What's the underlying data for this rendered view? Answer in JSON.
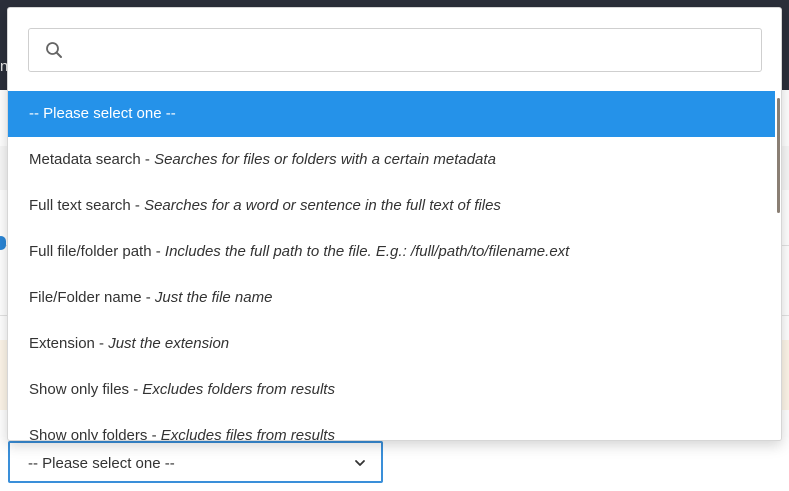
{
  "background": {
    "topbar_edge_letter": "n"
  },
  "search": {
    "placeholder": "",
    "value": ""
  },
  "options": [
    {
      "label": "-- Please select one --",
      "desc": "",
      "selected": true
    },
    {
      "label": "Metadata search",
      "desc": "Searches for files or folders with a certain metadata"
    },
    {
      "label": "Full text search",
      "desc": "Searches for a word or sentence in the full text of files"
    },
    {
      "label": "Full file/folder path",
      "desc": "Includes the full path to the file. E.g.: /full/path/to/filename.ext"
    },
    {
      "label": "File/Folder name",
      "desc": "Just the file name"
    },
    {
      "label": "Extension",
      "desc": "Just the extension"
    },
    {
      "label": "Show only files",
      "desc": "Excludes folders from results"
    },
    {
      "label": "Show only folders",
      "desc": "Excludes files from results"
    }
  ],
  "separator": " - ",
  "select": {
    "value": "-- Please select one --"
  },
  "colors": {
    "selected_bg": "#2592e9",
    "focus_border": "#3a8fd9",
    "topbar": "#2b2f3a"
  },
  "icons": {
    "search": "search-icon",
    "dropdown": "chevron-down-icon"
  }
}
